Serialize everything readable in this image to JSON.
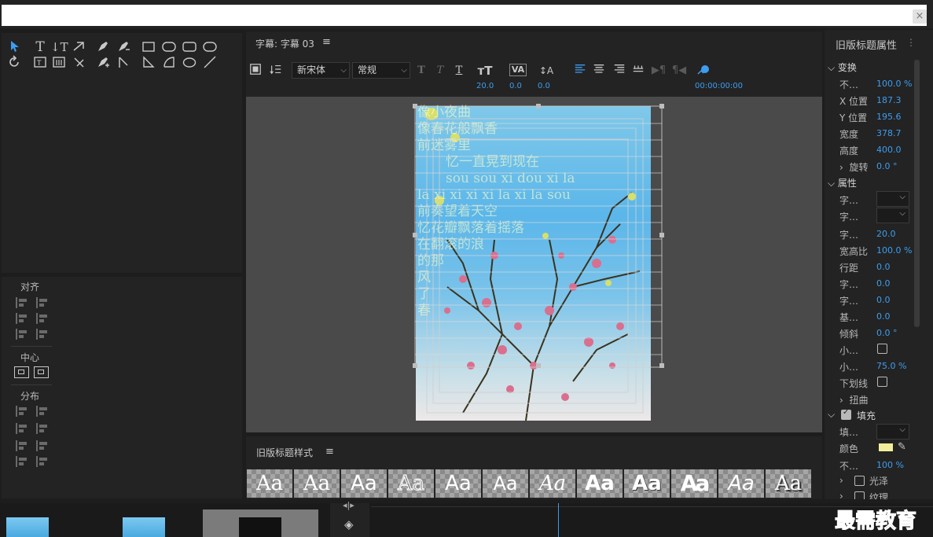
{
  "window": {
    "close_glyph": "×"
  },
  "title_panel": {
    "tab": "字幕: 字幕 03",
    "menu_glyph": "≡",
    "font_family": "新宋体",
    "font_style": "常规",
    "font_size": "20.0",
    "kerning": "0.0",
    "baseline": "0.0",
    "timecode": "00:00:00:00"
  },
  "align_panel": {
    "align_label": "对齐",
    "center_label": "中心",
    "distribute_label": "分布"
  },
  "canvas": {
    "lines": [
      "像小夜曲",
      "像春花般飘香",
      "前迷雾里",
      "忆一直晃到现在",
      "sou sou xi dou xi la",
      "la xi xi xi xi la xi la sou",
      "前奏望着天空",
      "忆花瓣飘落着摇落",
      "在翻滚的浪",
      "的那",
      "风",
      "了",
      "春"
    ]
  },
  "styles_panel": {
    "title": "旧版标题样式",
    "menu_glyph": "≡",
    "samples": [
      "Aa",
      "Aa",
      "Aa",
      "Aa",
      "Aa",
      "Aa",
      "Aa",
      "Aa",
      "Aa",
      "Aa",
      "Aa",
      "Aa"
    ]
  },
  "props_panel": {
    "title": "旧版标题属性",
    "transform": "变换",
    "rows": [
      {
        "label": "不…",
        "value": "100.0 %"
      },
      {
        "label": "X 位置",
        "value": "187.3"
      },
      {
        "label": "Y 位置",
        "value": "195.6"
      },
      {
        "label": "宽度",
        "value": "378.7"
      },
      {
        "label": "高度",
        "value": "400.0"
      }
    ],
    "rotate_label": "旋转",
    "rotate_value": "0.0 °",
    "attributes": "属性",
    "attr_rows": [
      {
        "label": "字…",
        "value": ""
      },
      {
        "label": "字…",
        "value": ""
      },
      {
        "label": "字…",
        "value": "20.0"
      },
      {
        "label": "宽高比",
        "value": "100.0 %"
      },
      {
        "label": "行距",
        "value": "0.0"
      },
      {
        "label": "字…",
        "value": "0.0"
      },
      {
        "label": "字…",
        "value": "0.0"
      },
      {
        "label": "基…",
        "value": "0.0"
      },
      {
        "label": "倾斜",
        "value": "0.0 °"
      },
      {
        "label": "小…",
        "value": ""
      },
      {
        "label": "小…",
        "value": "75.0 %"
      },
      {
        "label": "下划线",
        "value": ""
      }
    ],
    "distort": "扭曲",
    "fill": "填充",
    "fill_rows": [
      {
        "label": "填…",
        "value": ""
      },
      {
        "label": "颜色",
        "value": ""
      },
      {
        "label": "不…",
        "value": "100 %"
      }
    ],
    "sheen": "光泽",
    "texture": "纹理",
    "fill_color": "#f3ee9b"
  },
  "watermark": "最需教育",
  "colors": {
    "accent": "#3d9dee",
    "panel": "#232323",
    "bg": "#1d1d1d"
  }
}
